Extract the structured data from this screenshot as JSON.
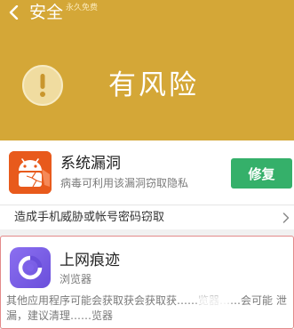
{
  "header": {
    "title": "安全",
    "subtitle": "永久免费",
    "status": "有风险",
    "background_color": "#d4a737"
  },
  "vulnerability": {
    "icon": "android-app-icon",
    "title": "系统漏洞",
    "description": "病毒可利用该漏洞窃取隐私",
    "action_label": "修复",
    "action_color": "#35b06a",
    "threat_summary": "造成手机威胁或帐号密码窃取"
  },
  "browser_trace": {
    "icon": "browser-app-icon",
    "title": "上网痕迹",
    "category": "浏览器",
    "description": "其他应用程序可能会获取获会获取获……览器……会可能 泄漏，建议清理……览器"
  }
}
